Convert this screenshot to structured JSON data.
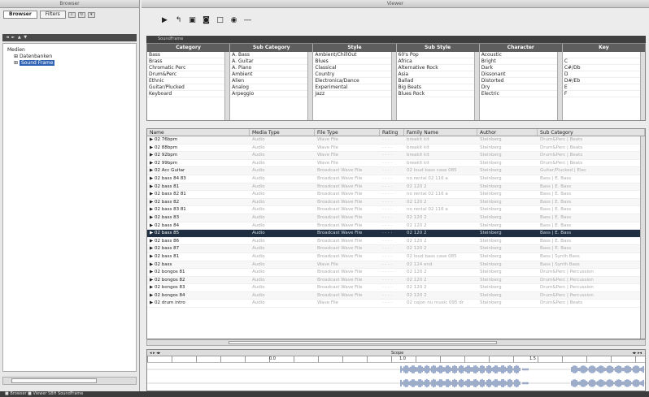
{
  "browser": {
    "title": "Browser",
    "tabs": [
      {
        "label": "Browser",
        "active": true
      },
      {
        "label": "Filters",
        "active": false
      }
    ],
    "tree_header": "◄ ► ▲ ▼",
    "tree": [
      {
        "label": "Medien",
        "indent": 0,
        "selected": false
      },
      {
        "label": "Datenbanken",
        "indent": 1,
        "selected": false
      },
      {
        "label": "Sound Frame",
        "indent": 1,
        "selected": true
      }
    ]
  },
  "viewer": {
    "title": "Viewer",
    "toolbar": [
      "play-icon",
      "loop-icon",
      "stop-icon",
      "record-icon",
      "square-icon",
      "volume-icon",
      "dash-icon"
    ],
    "filter_header": "SoundFrame",
    "filters": [
      {
        "header": "Category",
        "items": [
          "Bass",
          "Brass",
          "Chromatic Perc",
          "Drum&Perc",
          "Ethnic",
          "Guitar/Plucked",
          "Keyboard"
        ]
      },
      {
        "header": "Sub Category",
        "items": [
          "A. Bass",
          "A. Guitar",
          "A. Piano",
          "Ambient",
          "Alien",
          "Analog",
          "Arpeggio"
        ]
      },
      {
        "header": "Style",
        "items": [
          "Ambient/ChillOut",
          "Blues",
          "Classical",
          "Country",
          "Electronica/Dance",
          "Experimental",
          "Jazz"
        ]
      },
      {
        "header": "Sub Style",
        "items": [
          "60's Pop",
          "Africa",
          "Alternative Rock",
          "Asia",
          "Ballad",
          "Big Beats",
          "Blues Rock"
        ]
      },
      {
        "header": "Character",
        "items": [
          "Acoustic",
          "Bright",
          "Dark",
          "Dissonant",
          "Distorted",
          "Dry",
          "Electric"
        ]
      },
      {
        "header": "Key",
        "items": [
          "",
          "C",
          "C#/Db",
          "D",
          "D#/Eb",
          "E",
          "F"
        ]
      }
    ],
    "columns": [
      "Name",
      "Media Type",
      "File Type",
      "Rating",
      "Family Name",
      "Author",
      "Sub Category"
    ],
    "rows": [
      {
        "name": "▶ 02 76bpm",
        "media": "Audio",
        "file": "Wave File",
        "rating": "· · · ·",
        "family": "breakit kit",
        "author": "Steinberg",
        "sub": "Drum&Perc | Beats",
        "selected": false
      },
      {
        "name": "▶ 02 88bpm",
        "media": "Audio",
        "file": "Wave File",
        "rating": "· · · ·",
        "family": "breakit kit",
        "author": "Steinberg",
        "sub": "Drum&Perc | Beats",
        "selected": false
      },
      {
        "name": "▶ 02 92bpm",
        "media": "Audio",
        "file": "Wave File",
        "rating": "· · · ·",
        "family": "breakit kit",
        "author": "Steinberg",
        "sub": "Drum&Perc | Beats",
        "selected": false
      },
      {
        "name": "▶ 02 99bpm",
        "media": "Audio",
        "file": "Wave File",
        "rating": "· · · ·",
        "family": "breakit kit",
        "author": "Steinberg",
        "sub": "Drum&Perc | Beats",
        "selected": false
      },
      {
        "name": "▶ 02 Acc Guitar",
        "media": "Audio",
        "file": "Broadcast Wave File",
        "rating": "· · · ·",
        "family": "02 loud bass case 085",
        "author": "Steinberg",
        "sub": "Guitar/Plucked | Elec",
        "selected": false
      },
      {
        "name": "▶ 02 bass 84 83",
        "media": "Audio",
        "file": "Broadcast Wave File",
        "rating": "· · · ·",
        "family": "no rental 02 116 a",
        "author": "Steinberg",
        "sub": "Bass | E. Bass",
        "selected": false
      },
      {
        "name": "▶ 02 bass 81",
        "media": "Audio",
        "file": "Broadcast Wave File",
        "rating": "· · · ·",
        "family": "02 120 2",
        "author": "Steinberg",
        "sub": "Bass | E. Bass",
        "selected": false
      },
      {
        "name": "▶ 02 bass 82 81",
        "media": "Audio",
        "file": "Broadcast Wave File",
        "rating": "· · · ·",
        "family": "no rental 02 116 a",
        "author": "Steinberg",
        "sub": "Bass | E. Bass",
        "selected": false
      },
      {
        "name": "▶ 02 bass 82",
        "media": "Audio",
        "file": "Broadcast Wave File",
        "rating": "· · · ·",
        "family": "02 120 2",
        "author": "Steinberg",
        "sub": "Bass | E. Bass",
        "selected": false
      },
      {
        "name": "▶ 02 bass 83 81",
        "media": "Audio",
        "file": "Broadcast Wave File",
        "rating": "· · · ·",
        "family": "no rental 02 116 a",
        "author": "Steinberg",
        "sub": "Bass | E. Bass",
        "selected": false
      },
      {
        "name": "▶ 02 bass 83",
        "media": "Audio",
        "file": "Broadcast Wave File",
        "rating": "· · · ·",
        "family": "02 120 2",
        "author": "Steinberg",
        "sub": "Bass | E. Bass",
        "selected": false
      },
      {
        "name": "▶ 02 bass 84",
        "media": "Audio",
        "file": "Broadcast Wave File",
        "rating": "· · · ·",
        "family": "02 120 2",
        "author": "Steinberg",
        "sub": "Bass | E. Bass",
        "selected": false
      },
      {
        "name": "▶ 02 bass 85",
        "media": "Audio",
        "file": "Broadcast Wave File",
        "rating": "· · · ·",
        "family": "02 120 2",
        "author": "Steinberg",
        "sub": "Bass | E. Bass",
        "selected": true
      },
      {
        "name": "▶ 02 bass 86",
        "media": "Audio",
        "file": "Broadcast Wave File",
        "rating": "· · · ·",
        "family": "02 120 2",
        "author": "Steinberg",
        "sub": "Bass | E. Bass",
        "selected": false
      },
      {
        "name": "▶ 02 bass 87",
        "media": "Audio",
        "file": "Broadcast Wave File",
        "rating": "· · · ·",
        "family": "02 120 2",
        "author": "Steinberg",
        "sub": "Bass | E. Bass",
        "selected": false
      },
      {
        "name": "▶ 02 bass 81",
        "media": "Audio",
        "file": "Broadcast Wave File",
        "rating": "· · · ·",
        "family": "02 loud bass case 085",
        "author": "Steinberg",
        "sub": "Bass | Synth Bass",
        "selected": false
      },
      {
        "name": "▶ 02 bass",
        "media": "Audio",
        "file": "Wave File",
        "rating": "· · · ·",
        "family": "02 124 end",
        "author": "Steinberg",
        "sub": "Bass | Synth Bass",
        "selected": false
      },
      {
        "name": "▶ 02 bongos 81",
        "media": "Audio",
        "file": "Broadcast Wave File",
        "rating": "· · · ·",
        "family": "02 120 2",
        "author": "Steinberg",
        "sub": "Drum&Perc | Percussion",
        "selected": false
      },
      {
        "name": "▶ 02 bongos 82",
        "media": "Audio",
        "file": "Broadcast Wave File",
        "rating": "· · · ·",
        "family": "02 120 2",
        "author": "Steinberg",
        "sub": "Drum&Perc | Percussion",
        "selected": false
      },
      {
        "name": "▶ 02 bongos 83",
        "media": "Audio",
        "file": "Broadcast Wave File",
        "rating": "· · · ·",
        "family": "02 120 2",
        "author": "Steinberg",
        "sub": "Drum&Perc | Percussion",
        "selected": false
      },
      {
        "name": "▶ 02 bongos 84",
        "media": "Audio",
        "file": "Broadcast Wave File",
        "rating": "· · · ·",
        "family": "02 120 2",
        "author": "Steinberg",
        "sub": "Drum&Perc | Percussion",
        "selected": false
      },
      {
        "name": "▶ 02 drum intro",
        "media": "Audio",
        "file": "Wave File",
        "rating": "· · · ·",
        "family": "02 cajon nu music 095 dr",
        "author": "Steinberg",
        "sub": "Drum&Perc | Beats",
        "selected": false
      }
    ],
    "wave_label": "Scope",
    "ruler_marks": [
      "0.0",
      "1.0",
      "1.5"
    ]
  },
  "status": {
    "text": "■ Browser  ■ Viewer          SBH  SoundFrame"
  }
}
